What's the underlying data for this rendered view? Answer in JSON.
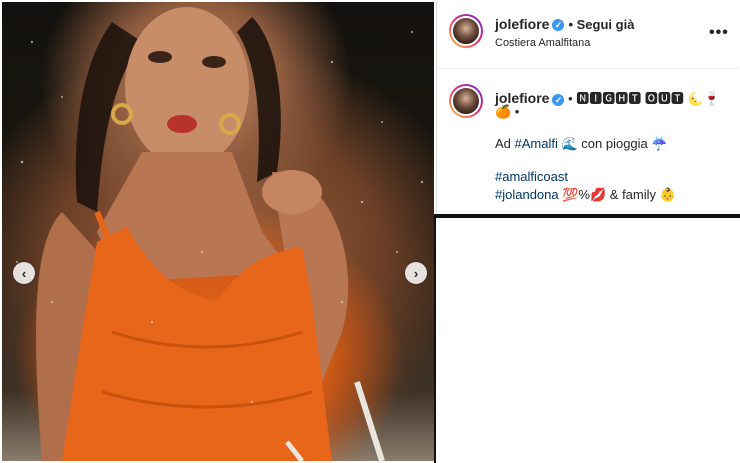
{
  "post": {
    "username": "jolefiore",
    "verified_icon": "verified-badge-icon",
    "follow_status": "• Segui già",
    "location": "Costiera Amalfitana",
    "more_icon": "•••"
  },
  "caption": {
    "username": "jolefiore",
    "line1_text": "• 🅽🅸🅶🅷🆃 🅾🆄🆃 🌜🍷",
    "line2_text": "🍊 •",
    "line3_prefix": "Ad ",
    "line3_tag": "#Amalfi",
    "line3_suffix": " 🌊 con pioggia ☔",
    "line4_tag": "#amalficoast",
    "line5_tag": "#jolandona",
    "line5_suffix": " 💯%💋 & family 👶"
  },
  "nav": {
    "prev_symbol": "‹",
    "next_symbol": "›"
  },
  "colors": {
    "accent": "#3897f0",
    "hashtag": "#00376b",
    "dress": "#e6681c"
  }
}
